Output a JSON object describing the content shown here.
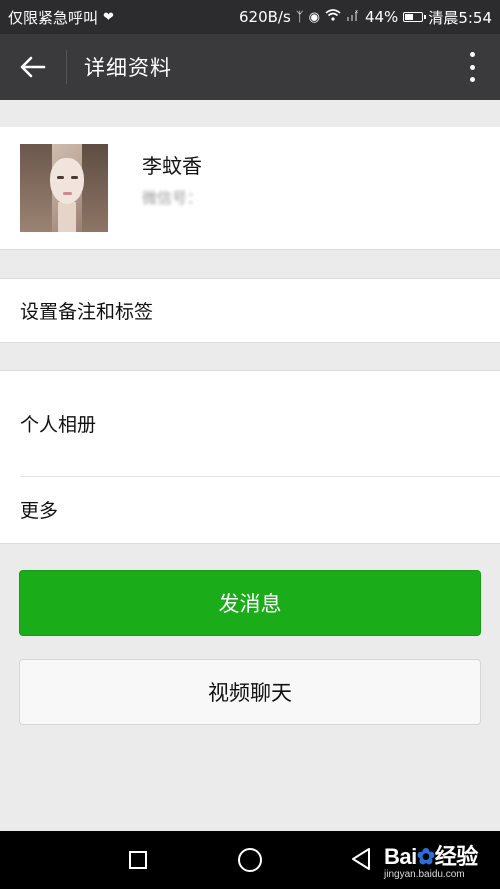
{
  "status_bar": {
    "carrier_text": "仅限紧急呼叫",
    "net_speed": "620B/s",
    "battery_percent": "44%",
    "time": "清晨5:54",
    "battery_level": 0.44
  },
  "title_bar": {
    "title": "详细资料",
    "back_icon": "arrow-left-icon",
    "more_icon": "more-vertical-icon"
  },
  "profile": {
    "name": "李蚊香",
    "wechat_id": "微信号："
  },
  "rows": {
    "remark": "设置备注和标签",
    "album": "个人相册",
    "more": "更多"
  },
  "actions": {
    "send_message": "发消息",
    "video_chat": "视频聊天"
  },
  "colors": {
    "primary_green": "#1aad19",
    "title_bar": "#3a3a3c",
    "status_bar": "#2c2c2e"
  },
  "watermark": {
    "brand": "Bai",
    "brand_suffix": "经验",
    "url": "jingyan.baidu.com"
  }
}
